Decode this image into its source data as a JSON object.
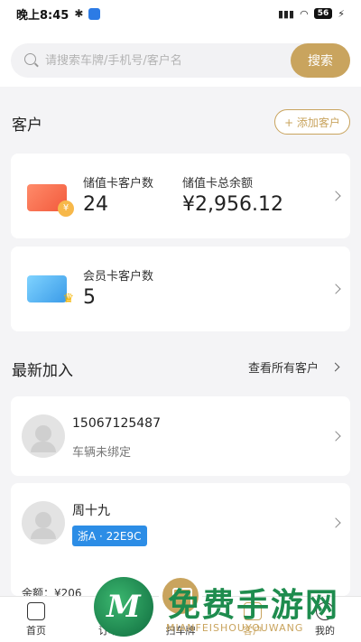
{
  "status_bar": {
    "time": "晚上8:45",
    "battery": "56"
  },
  "search": {
    "placeholder": "请搜索车牌/手机号/客户名",
    "button": "搜索"
  },
  "customer_section": {
    "title": "客户",
    "add_button": "+ 添加客户"
  },
  "stored_value_card": {
    "count_label": "储值卡客户数",
    "count_value": "24",
    "balance_label": "储值卡总余额",
    "balance_value": "¥2,956.12",
    "icon_badge": "¥"
  },
  "member_card": {
    "count_label": "会员卡客户数",
    "count_value": "5"
  },
  "recent": {
    "title": "最新加入",
    "view_all": "查看所有客户",
    "customers": [
      {
        "name": "15067125487",
        "subtitle": "车辆未绑定"
      },
      {
        "name": "周十九",
        "plate": "浙A · 22E9C"
      }
    ],
    "partial_balance": "余额：¥206"
  },
  "tabbar": {
    "tabs": [
      {
        "label": "首页"
      },
      {
        "label": "订单"
      },
      {
        "label": "扫车牌"
      },
      {
        "label": "客户"
      },
      {
        "label": "我的"
      }
    ]
  },
  "watermark": {
    "logo": "M",
    "text": "免费手游网",
    "sub": "MIANFEISHOUYOUWANG"
  }
}
